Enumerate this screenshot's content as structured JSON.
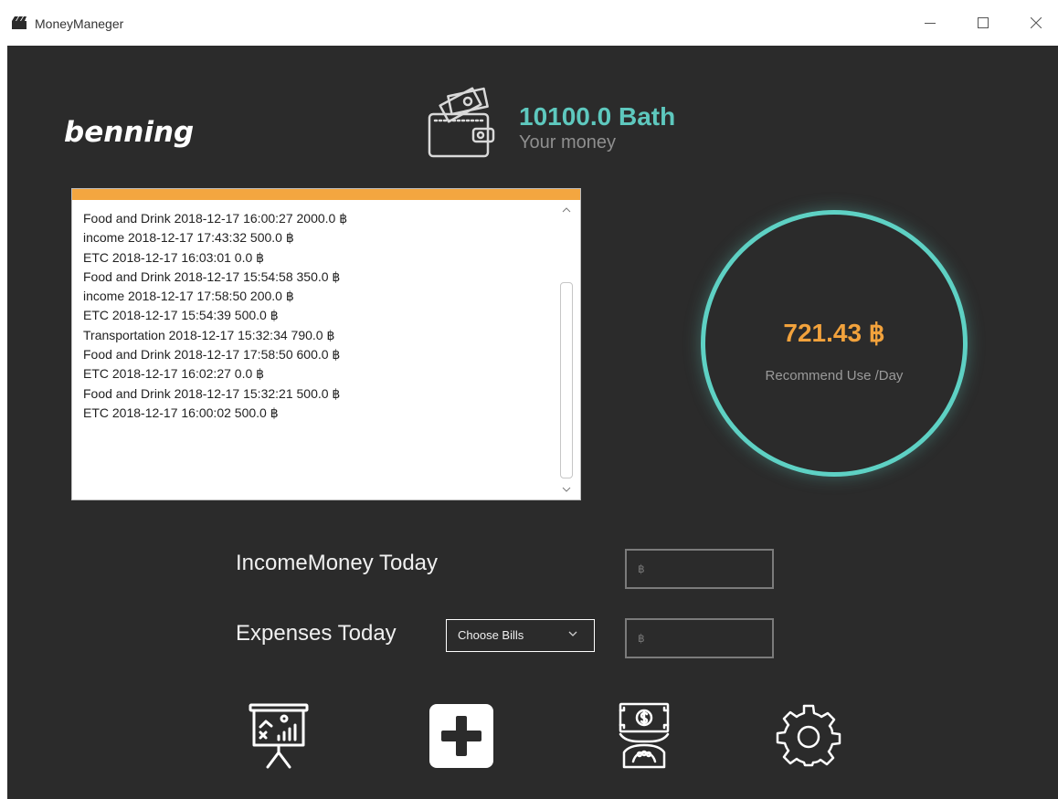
{
  "window": {
    "title": "MoneyManeger"
  },
  "user": {
    "name": "benning"
  },
  "balance": {
    "amount": "10100.0 Bath",
    "label": "Your money",
    "icon": "wallet-icon"
  },
  "transactions": [
    "Food and Drink 2018-12-17 16:00:27 2000.0 ฿",
    "income 2018-12-17 17:43:32 500.0 ฿",
    "ETC 2018-12-17 16:03:01 0.0 ฿",
    "Food and Drink 2018-12-17 15:54:58 350.0 ฿",
    "income 2018-12-17 17:58:50 200.0 ฿",
    "ETC 2018-12-17 15:54:39 500.0 ฿",
    "Transportation 2018-12-17 15:32:34 790.0 ฿",
    "Food and Drink 2018-12-17 17:58:50 600.0 ฿",
    "ETC 2018-12-17 16:02:27 0.0 ฿",
    "Food and Drink 2018-12-17 15:32:21 500.0 ฿",
    "ETC 2018-12-17 16:00:02 500.0 ฿"
  ],
  "recommendation": {
    "amount": "721.43 ฿",
    "label": "Recommend Use /Day"
  },
  "form": {
    "income_label": "IncomeMoney Today",
    "income_placeholder": "฿",
    "expense_label": "Expenses Today",
    "bills_selected": "Choose Bills",
    "expense_placeholder": "฿"
  },
  "colors": {
    "background": "#2b2b2b",
    "accent_teal": "#5ed1c4",
    "accent_orange": "#f2a23c",
    "list_header": "#f3a640"
  },
  "toolbar": {
    "icons": [
      "chart-presentation-icon",
      "add-icon",
      "money-cash-icon",
      "gear-icon"
    ]
  }
}
